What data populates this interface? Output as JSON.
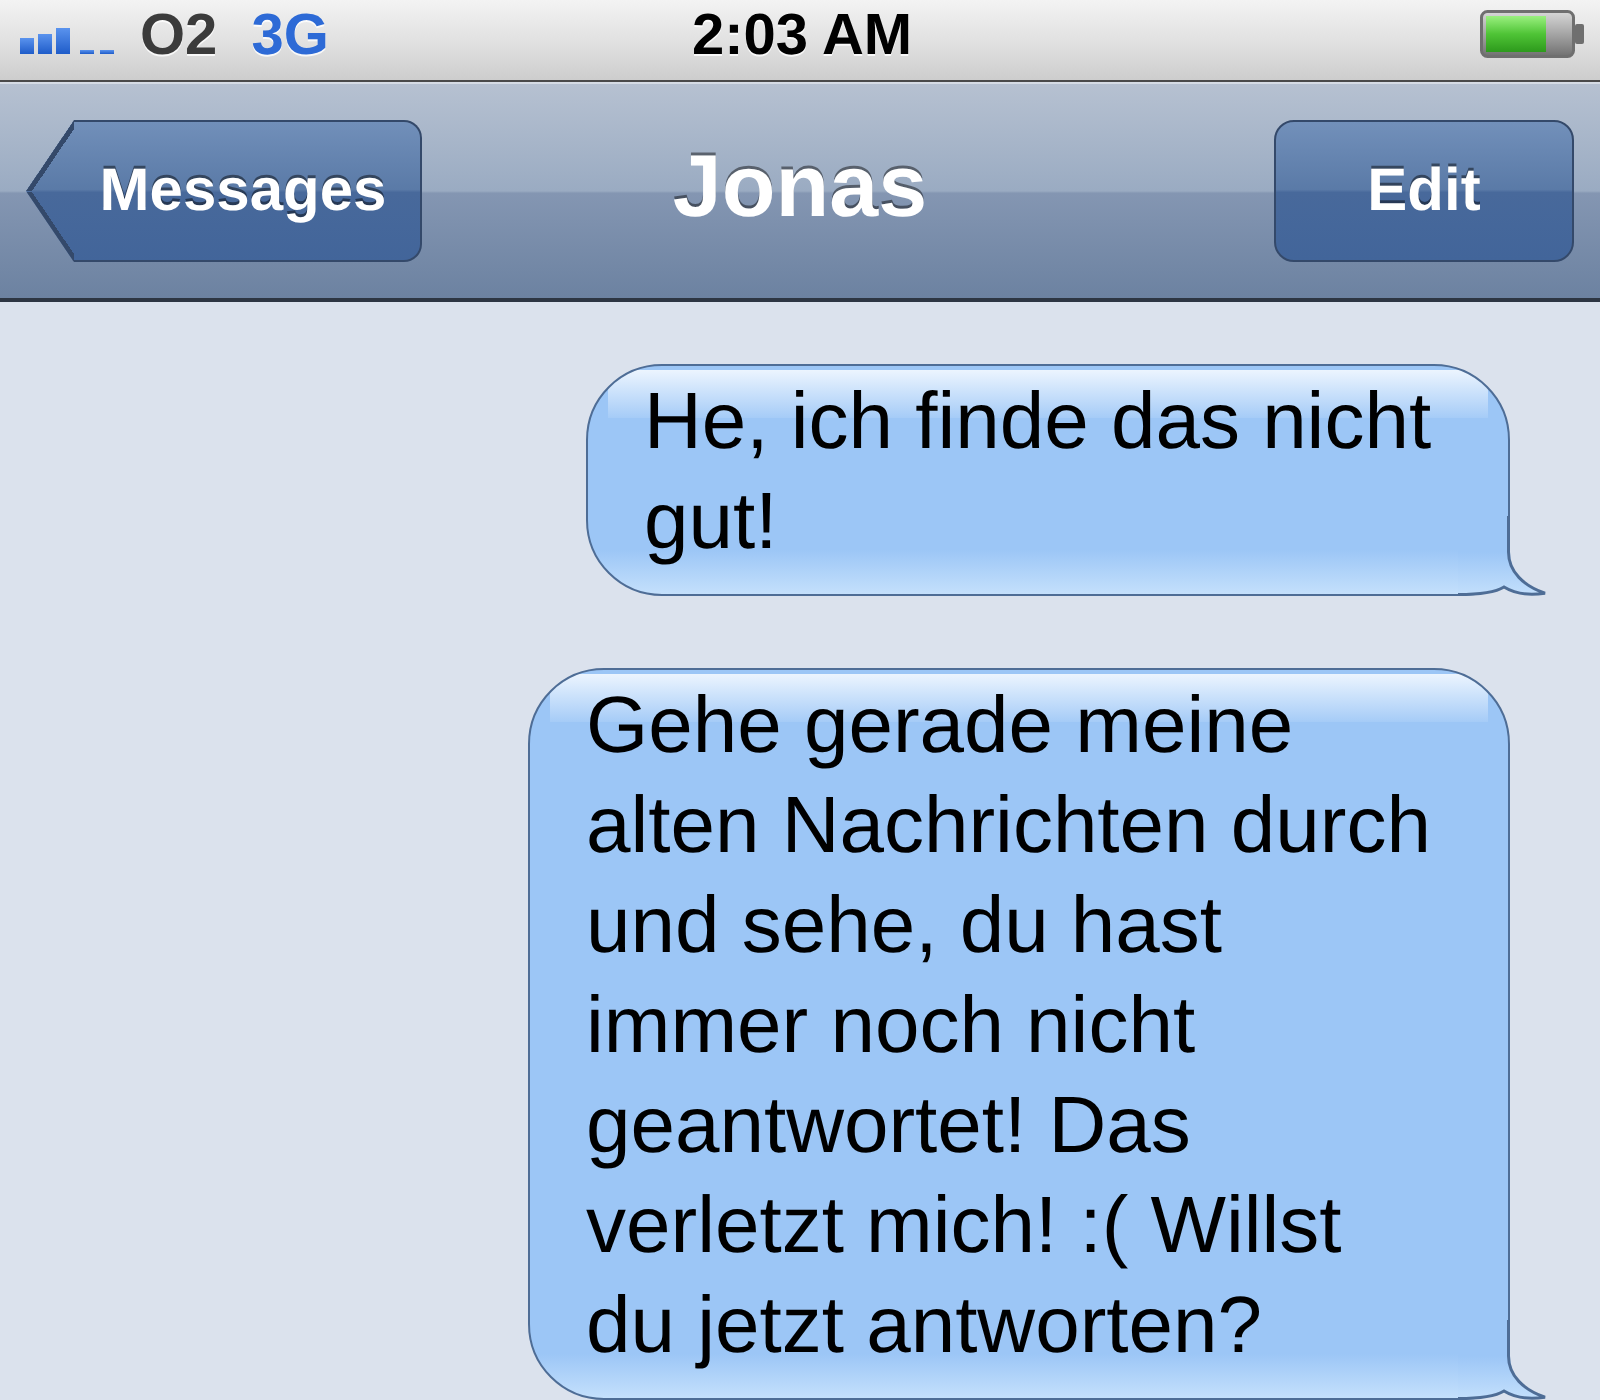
{
  "status_bar": {
    "carrier": "O2",
    "network": "3G",
    "time": "2:03 AM"
  },
  "nav_bar": {
    "back_button": "Messages",
    "title": "Jonas",
    "edit_button": "Edit"
  },
  "messages": [
    {
      "kind": "sent",
      "text": "He, ich finde das nicht gut!"
    },
    {
      "kind": "sent",
      "text": "Gehe gerade meine alten Nachrichten durch und sehe, du hast immer noch nicht geantwortet! Das verletzt mich! :( Willst du jetzt antworten?"
    }
  ]
}
